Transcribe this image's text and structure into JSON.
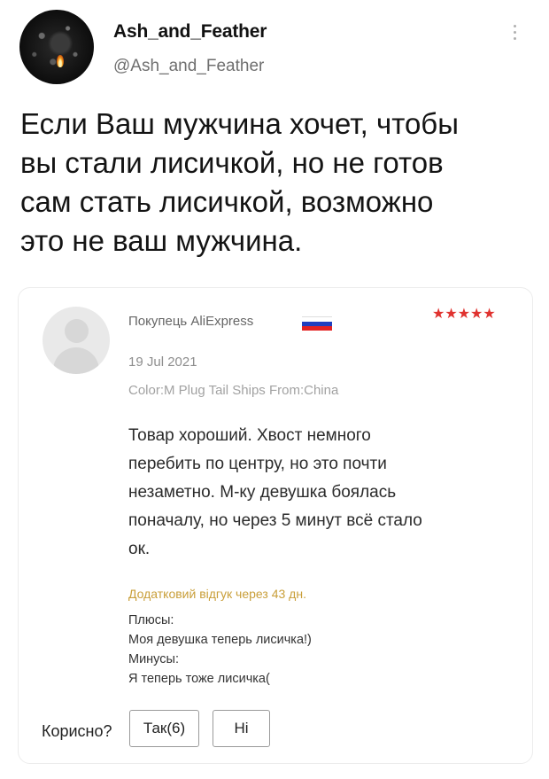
{
  "tweet": {
    "author_name": "Ash_and_Feather",
    "author_handle": "@Ash_and_Feather",
    "menu_icon": "more-vertical-icon",
    "text_lines": [
      "Если Ваш мужчина хочет, чтобы",
      "вы стали лисичкой, но не готов",
      "сам стать лисичкой, возможно",
      "это не ваш мужчина."
    ]
  },
  "review": {
    "buyer_label": "Покупець AliExpress",
    "flag_colors": [
      "#ffffff",
      "#1f3fbf",
      "#e32222"
    ],
    "stars": "★★★★★",
    "star_color": "#e0322f",
    "date": "19 Jul 2021",
    "sku": "Color:M Plug Tail Ships From:China",
    "body_lines": [
      "Товар хороший. Хвост немного",
      "перебить по центру, но это почти",
      "незаметно. М-ку девушка боялась",
      "поначалу, но через 5 минут всё стало",
      "ок."
    ],
    "followup_label": "Додатковий відгук через 43 дн.",
    "followup_lines": [
      "Плюсы:",
      "Моя девушка теперь лисичка!)",
      "Минусы:",
      "Я теперь тоже лисичка("
    ],
    "helpful": {
      "label": "Корисно?",
      "yes_label": "Так(6)",
      "no_label": "Ні"
    }
  }
}
